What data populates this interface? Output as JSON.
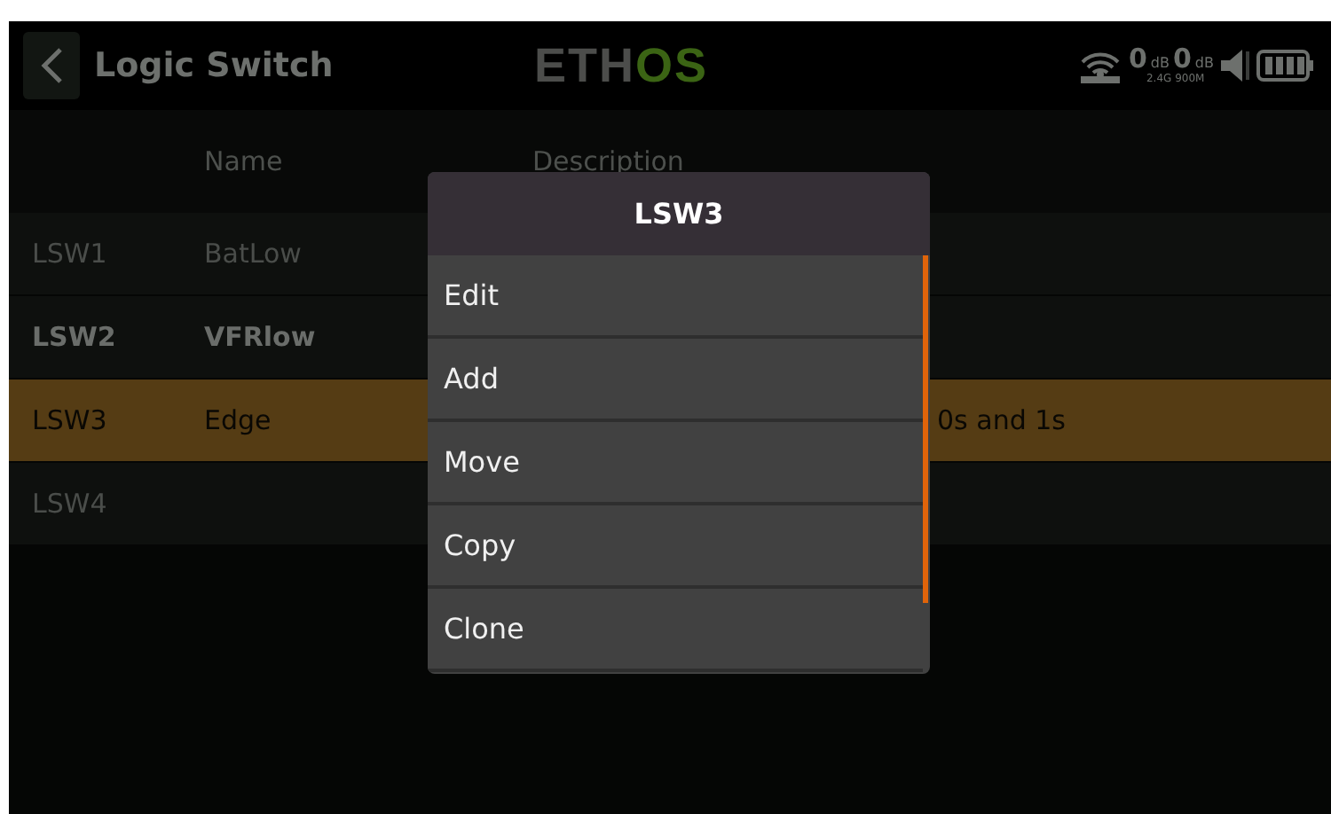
{
  "header": {
    "title": "Logic Switch",
    "logo": [
      "ETH",
      "OS"
    ],
    "rf": [
      {
        "value": "0",
        "unit": "dB"
      },
      {
        "value": "0",
        "unit": "dB"
      }
    ],
    "bands": "2.4G 900M"
  },
  "table": {
    "columns": [
      "Name",
      "Description"
    ],
    "rows": [
      {
        "id": "LSW1",
        "name": "BatLow",
        "description": "",
        "enabled": false,
        "selected": false
      },
      {
        "id": "LSW2",
        "name": "VFRlow",
        "description": "",
        "enabled": true,
        "selected": false
      },
      {
        "id": "LSW3",
        "name": "Edge",
        "description": "0s and 1s",
        "enabled": true,
        "selected": true
      },
      {
        "id": "LSW4",
        "name": "",
        "description": "",
        "enabled": false,
        "selected": false
      }
    ]
  },
  "menu": {
    "title": "LSW3",
    "items": [
      "Edit",
      "Add",
      "Move",
      "Copy",
      "Clone"
    ]
  }
}
